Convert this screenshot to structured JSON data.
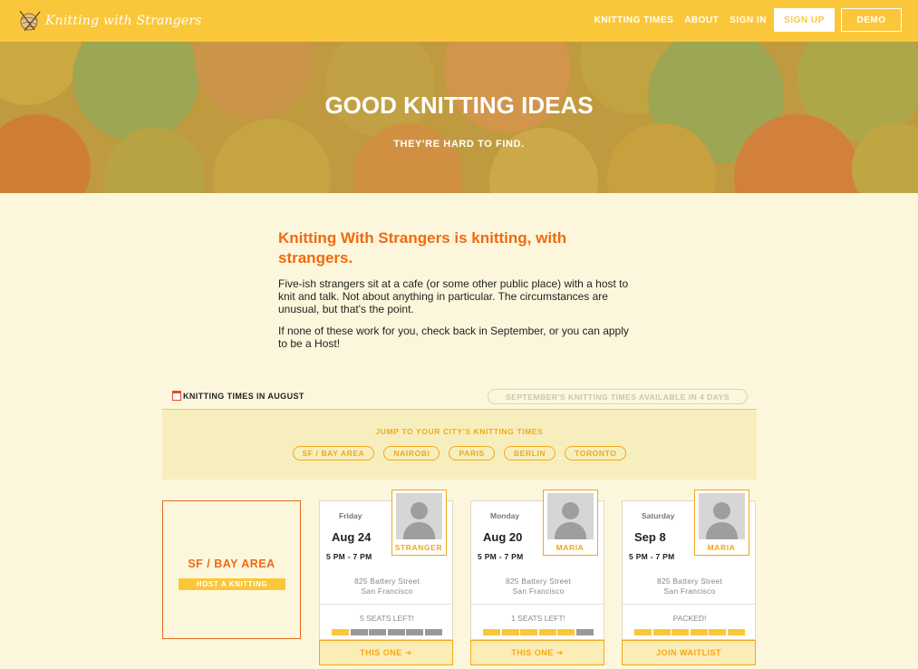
{
  "brand": {
    "name": "Knitting with Strangers",
    "logo_icon": "yarn-ball-icon"
  },
  "nav": {
    "links": [
      "KNITTING TIMES",
      "ABOUT",
      "SIGN IN"
    ],
    "signup_label": "SIGN UP",
    "demo_label": "DEMO"
  },
  "hero": {
    "title": "GOOD KNITTING IDEAS",
    "subtitle": "THEY'RE HARD TO FIND."
  },
  "intro": {
    "heading": "Knitting With Strangers is knitting, with strangers.",
    "para1": "Five-ish strangers sit at a cafe (or some other public place) with a host to knit and talk. Not about anything in particular. The circumstances are unusual, but that's the point.",
    "para2": "If none of these work for you, check back in September, or you can apply to be a Host!"
  },
  "times": {
    "title": "KNITTING TIMES IN AUGUST",
    "calendar_icon": "calendar-icon",
    "next_month_notice": "SEPTEMBER'S KNITTING TIMES AVAILABLE IN 4 DAYS",
    "jump_title": "JUMP TO YOUR CITY'S KNITTING TIMES",
    "cities": [
      "SF / BAY AREA",
      "NAIROBI",
      "PARIS",
      "BERLIN",
      "TORONTO"
    ]
  },
  "city_card": {
    "name": "SF / BAY AREA",
    "host_button": "HOST A KNITTING"
  },
  "events": [
    {
      "day": "Friday",
      "date": "Aug 24",
      "time": "5 PM - 7 PM",
      "address1": "825 Battery Street",
      "address2": "San Francisco",
      "host": "STRANGER",
      "seats_text": "5 SEATS LEFT!",
      "seats_filled": 1,
      "seats_total": 6,
      "button": "THIS ONE ➔"
    },
    {
      "day": "Monday",
      "date": "Aug 20",
      "time": "5 PM - 7 PM",
      "address1": "825 Battery Street",
      "address2": "San Francisco",
      "host": "MARIA",
      "seats_text": "1 SEATS LEFT!",
      "seats_filled": 5,
      "seats_total": 6,
      "button": "THIS ONE ➔"
    },
    {
      "day": "Saturday",
      "date": "Sep 8",
      "time": "5 PM - 7 PM",
      "address1": "825 Battery Street",
      "address2": "San Francisco",
      "host": "MARIA",
      "seats_text": "PACKED!",
      "seats_filled": 6,
      "seats_total": 6,
      "button": "JOIN WAITLIST"
    }
  ],
  "colors": {
    "brand_yellow": "#fbc73a",
    "accent_orange": "#f06a10",
    "page_bg": "#fcf7dc",
    "seat_empty": "#999999"
  }
}
